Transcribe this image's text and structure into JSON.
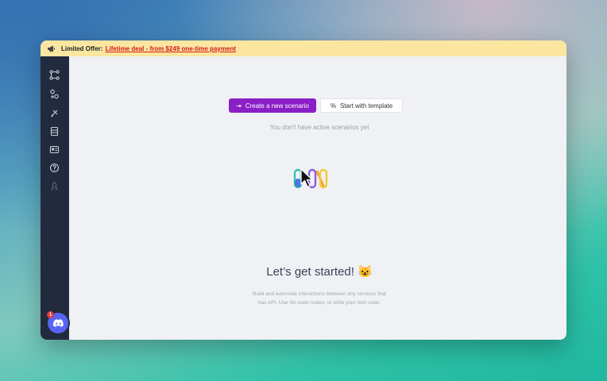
{
  "banner": {
    "prefix": "Limited Offer:",
    "link": "Lifetime deal - from $249 one-time payment"
  },
  "sidebar": {
    "items": [
      {
        "icon": "scenarios-icon"
      },
      {
        "icon": "connections-icon"
      },
      {
        "icon": "plugin-icon"
      },
      {
        "icon": "storage-icon"
      },
      {
        "icon": "templates-icon"
      },
      {
        "icon": "help-icon"
      },
      {
        "icon": "rocket-icon"
      }
    ],
    "discord_badge": "1"
  },
  "main": {
    "create_button": "Create a new scenario",
    "template_button": "Start with template",
    "empty_text": "You don't have active scenarios yet",
    "headline": "Let’s get started! 😺",
    "description": "Build and automate interactions between any services that has API. Use No-code nodes, or write your own code."
  },
  "colors": {
    "accent": "#8b1fc6",
    "sidebar": "#222a3d",
    "banner": "#fbe6a0",
    "banner_link": "#d21a1a",
    "discord": "#5865f2"
  }
}
